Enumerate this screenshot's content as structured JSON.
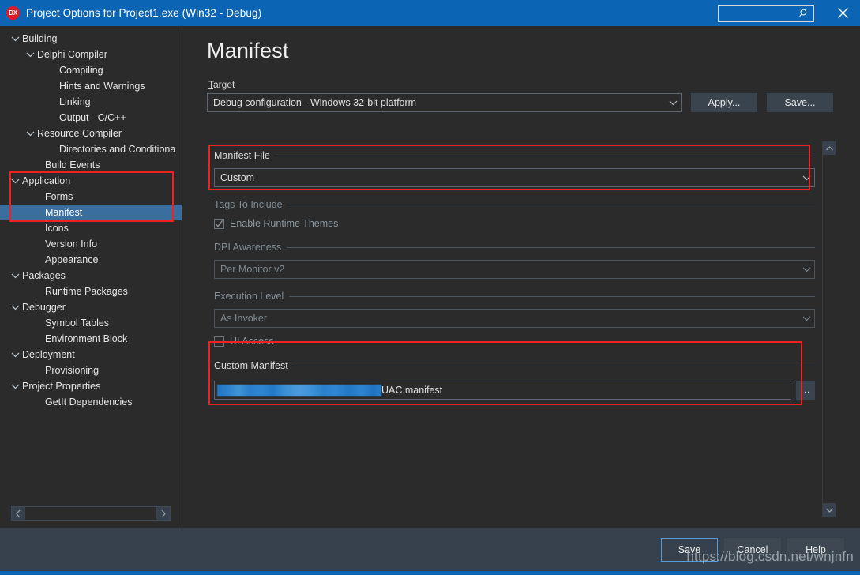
{
  "titlebar": {
    "logo": "DX",
    "title": "Project Options for Project1.exe  (Win32 - Debug)",
    "search_value": "",
    "search_placeholder": "",
    "search_icon": "search-icon",
    "close_icon": "close-icon"
  },
  "sidebar": {
    "items": [
      {
        "label": "Building",
        "level": 0,
        "chevron": "chevron-down",
        "selected": false
      },
      {
        "label": "Delphi Compiler",
        "level": 1,
        "chevron": "chevron-down",
        "selected": false
      },
      {
        "label": "Compiling",
        "level": 2,
        "chevron": "",
        "selected": false
      },
      {
        "label": "Hints and Warnings",
        "level": 2,
        "chevron": "",
        "selected": false
      },
      {
        "label": "Linking",
        "level": 2,
        "chevron": "",
        "selected": false
      },
      {
        "label": "Output - C/C++",
        "level": 2,
        "chevron": "",
        "selected": false
      },
      {
        "label": "Resource Compiler",
        "level": 1,
        "chevron": "chevron-down",
        "selected": false
      },
      {
        "label": "Directories and Conditiona",
        "level": 2,
        "chevron": "",
        "selected": false
      },
      {
        "label": "Build Events",
        "level": 1,
        "chevron": "",
        "selected": false
      },
      {
        "label": "Application",
        "level": 0,
        "chevron": "chevron-down",
        "selected": false
      },
      {
        "label": "Forms",
        "level": 1,
        "chevron": "",
        "selected": false
      },
      {
        "label": "Manifest",
        "level": 1,
        "chevron": "",
        "selected": true
      },
      {
        "label": "Icons",
        "level": 1,
        "chevron": "",
        "selected": false
      },
      {
        "label": "Version Info",
        "level": 1,
        "chevron": "",
        "selected": false
      },
      {
        "label": "Appearance",
        "level": 1,
        "chevron": "",
        "selected": false
      },
      {
        "label": "Packages",
        "level": 0,
        "chevron": "chevron-down",
        "selected": false
      },
      {
        "label": "Runtime Packages",
        "level": 1,
        "chevron": "",
        "selected": false
      },
      {
        "label": "Debugger",
        "level": 0,
        "chevron": "chevron-down",
        "selected": false
      },
      {
        "label": "Symbol Tables",
        "level": 1,
        "chevron": "",
        "selected": false
      },
      {
        "label": "Environment Block",
        "level": 1,
        "chevron": "",
        "selected": false
      },
      {
        "label": "Deployment",
        "level": 0,
        "chevron": "chevron-down",
        "selected": false
      },
      {
        "label": "Provisioning",
        "level": 1,
        "chevron": "",
        "selected": false
      },
      {
        "label": "Project Properties",
        "level": 0,
        "chevron": "chevron-down",
        "selected": false
      },
      {
        "label": "GetIt Dependencies",
        "level": 1,
        "chevron": "",
        "selected": false
      }
    ],
    "hscroll": {
      "left_icon": "chevron-left-icon",
      "right_icon": "chevron-right-icon"
    }
  },
  "main": {
    "page_title": "Manifest",
    "target": {
      "label": "Target",
      "accel": "T",
      "label_rest": "arget",
      "value": "Debug configuration - Windows 32-bit platform",
      "chevron": "chevron-down-icon"
    },
    "apply_button": {
      "accel": "A",
      "rest": "pply..."
    },
    "save_button": {
      "accel": "S",
      "rest": "ave..."
    },
    "manifest_file": {
      "title": "Manifest File",
      "value": "Custom"
    },
    "tags_to_include": {
      "title": "Tags To Include",
      "enable_runtime_themes": {
        "label": "Enable Runtime Themes",
        "checked": true,
        "disabled": true
      }
    },
    "dpi_awareness": {
      "title": "DPI Awareness",
      "value": "Per Monitor v2",
      "disabled": true
    },
    "execution_level": {
      "title": "Execution Level",
      "value": "As Invoker",
      "disabled": true,
      "ui_access": {
        "label": "UI Access",
        "checked": false,
        "disabled": true
      }
    },
    "custom_manifest": {
      "title": "Custom Manifest",
      "path_redacted": true,
      "path_visible_text": "UAC.manifest",
      "browse_button": "..."
    },
    "vscroll": {
      "up_icon": "chevron-up-icon",
      "down_icon": "chevron-down-icon"
    }
  },
  "bottombar": {
    "save": "Save",
    "cancel": "Cancel",
    "help": "Help"
  },
  "watermark": "https://blog.csdn.net/wnjnfn",
  "colors": {
    "titlebar": "#0c64b4",
    "window_bg": "#2b2b2b",
    "selection": "#3a6e9e",
    "annotation": "#ee2222",
    "bottom_bar": "#36414d",
    "accent_border": "#5b9bd5"
  }
}
